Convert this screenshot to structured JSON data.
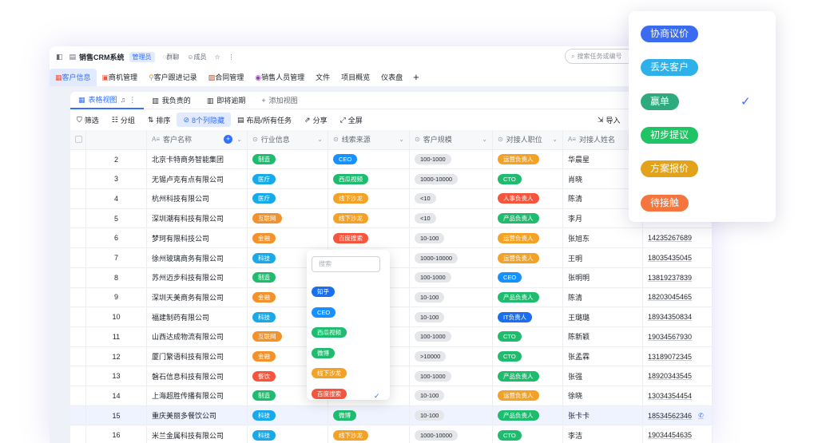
{
  "app": {
    "title": "销售CRM系统",
    "role_badge": "管理员",
    "links": [
      "群聊",
      "成员"
    ],
    "search_placeholder": "搜索任务或编号"
  },
  "menu": {
    "items": [
      "客户信息",
      "商机管理",
      "客户跟进记录",
      "合同管理",
      "销售人员管理",
      "文件",
      "项目概览",
      "仪表盘"
    ],
    "plus": "+"
  },
  "views": {
    "tabs": [
      "表格视图",
      "我负责的",
      "即将逾期"
    ],
    "add": "添加视图"
  },
  "toolbar": {
    "items": [
      "筛选",
      "分组",
      "排序",
      "8个列隐藏",
      "布局/所有任务",
      "分享",
      "全屏"
    ],
    "import": "导入"
  },
  "columns": [
    "客户名称",
    "行业信息",
    "线索来源",
    "客户规模",
    "对接人职位",
    "对接人姓名"
  ],
  "colors": {
    "制造": "#1fbc6f",
    "医疗": "#17a9e8",
    "互联网": "#f3922a",
    "金融": "#f3922a",
    "科技": "#17a9e8",
    "餐饮": "#f5553c",
    "CEO": "#1890ff",
    "西瓜视频": "#1fbc6f",
    "线下沙龙": "#f3a226",
    "百度搜索": "#f5553c",
    "微博": "#1fbc6f",
    "知乎": "#1a6ff0",
    "运营负责人": "#f3a226",
    "CTO": "#1fbc6f",
    "人事负责人": "#f5553c",
    "产品负责人": "#1fbc6f",
    "IT负责人": "#1a6ff0"
  },
  "rows": [
    {
      "n": "2",
      "name": "北京卡特商务智能集团",
      "ind": "制造",
      "src": "CEO",
      "size": "100-1000",
      "pos": "运营负责人",
      "contact": "华晨星",
      "phone": ""
    },
    {
      "n": "3",
      "name": "无锡卢克有点有限公司",
      "ind": "医疗",
      "src": "西瓜视频",
      "size": "1000-10000",
      "pos": "CTO",
      "contact": "肖晓",
      "phone": ""
    },
    {
      "n": "4",
      "name": "杭州科技有限公司",
      "ind": "医疗",
      "src": "线下沙龙",
      "size": "<10",
      "pos": "人事负责人",
      "contact": "陈清",
      "phone": ""
    },
    {
      "n": "5",
      "name": "深圳潮有科技有限公司",
      "ind": "互联网",
      "src": "线下沙龙",
      "size": "<10",
      "pos": "产品负责人",
      "contact": "李月",
      "phone": ""
    },
    {
      "n": "6",
      "name": "梦珂有限科技公司",
      "ind": "金融",
      "src": "百度搜索",
      "size": "10-100",
      "pos": "运营负责人",
      "contact": "张旭东",
      "phone": "14235267689"
    },
    {
      "n": "7",
      "name": "徐州玻璃商务有限公司",
      "ind": "科技",
      "src": "",
      "size": "1000-10000",
      "pos": "运营负责人",
      "contact": "王明",
      "phone": "18035435045"
    },
    {
      "n": "8",
      "name": "苏州迈步科技有限公司",
      "ind": "制造",
      "src": "",
      "size": "100-1000",
      "pos": "CEO",
      "contact": "张明明",
      "phone": "13819237839"
    },
    {
      "n": "9",
      "name": "深圳天美商务有限公司",
      "ind": "金融",
      "src": "",
      "size": "10-100",
      "pos": "产品负责人",
      "contact": "陈清",
      "phone": "18203045465"
    },
    {
      "n": "10",
      "name": "福建制药有限公司",
      "ind": "科技",
      "src": "",
      "size": "10-100",
      "pos": "IT负责人",
      "contact": "王璐璐",
      "phone": "18934350834"
    },
    {
      "n": "11",
      "name": "山西达成物流有限公司",
      "ind": "互联网",
      "src": "",
      "size": "100-1000",
      "pos": "CTO",
      "contact": "陈新颖",
      "phone": "19034567930"
    },
    {
      "n": "12",
      "name": "厦门繁语科技有限公司",
      "ind": "金融",
      "src": "",
      "size": ">10000",
      "pos": "CTO",
      "contact": "张孟霖",
      "phone": "13189072345"
    },
    {
      "n": "13",
      "name": "磐石信息科技有限公司",
      "ind": "餐饮",
      "src": "",
      "size": "100-1000",
      "pos": "产品负责人",
      "contact": "张强",
      "phone": "18920343545"
    },
    {
      "n": "14",
      "name": "上海超胜传播有限公司",
      "ind": "制造",
      "src": "",
      "size": "10-100",
      "pos": "运营负责人",
      "contact": "徐晓",
      "phone": "13034354454"
    },
    {
      "n": "15",
      "name": "重庆美丽多餐饮公司",
      "ind": "科技",
      "src": "微博",
      "size": "10-100",
      "pos": "产品负责人",
      "contact": "张卡卡",
      "phone": "18534562346"
    },
    {
      "n": "16",
      "name": "米兰金属科技有限公司",
      "ind": "科技",
      "src": "线下沙龙",
      "size": "1000-10000",
      "pos": "CTO",
      "contact": "李洁",
      "phone": "19034454635"
    }
  ],
  "dropdown": {
    "placeholder": "搜索",
    "options": [
      "知乎",
      "CEO",
      "西瓜视频",
      "微博",
      "线下沙龙",
      "百度搜索"
    ]
  },
  "stage_options": [
    {
      "label": "协商议价",
      "color": "#3b6cf0"
    },
    {
      "label": "丢失客户",
      "color": "#2eb1ea"
    },
    {
      "label": "赢单",
      "color": "#2faa7e"
    },
    {
      "label": "初步提议",
      "color": "#20c464"
    },
    {
      "label": "方案报价",
      "color": "#e2a21c"
    },
    {
      "label": "待接触",
      "color": "#f4763e"
    }
  ]
}
